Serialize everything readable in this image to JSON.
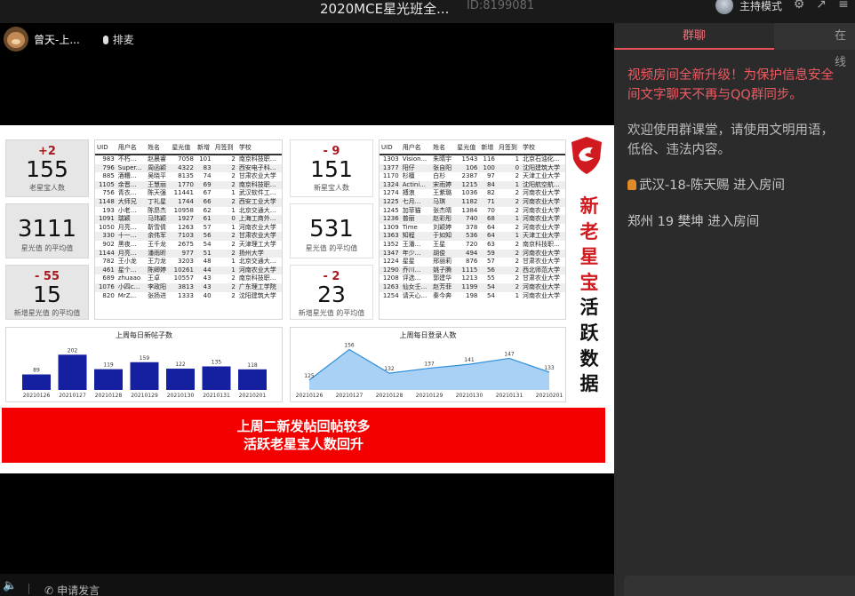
{
  "topbar": {
    "title": "2020MCE星光班全...",
    "room_id": "ID:8199081",
    "mode": "主持模式",
    "icons": [
      "settings-icon",
      "share-icon",
      "menu-icon"
    ]
  },
  "presenter": {
    "name": "曾天-上...",
    "mic_label": "排麦"
  },
  "slide": {
    "kpis": {
      "old_active": {
        "delta": "+2",
        "value": "155",
        "label": "老星宝人数"
      },
      "old_avg": {
        "value": "3111",
        "label": "星光值 的平均值"
      },
      "old_new_avg": {
        "delta": "- 55",
        "value": "15",
        "label": "新增星光值 的平均值"
      },
      "new_count": {
        "delta": "- 9",
        "value": "151",
        "label": "新星宝人数"
      },
      "new_avg": {
        "value": "531",
        "label": "星光值 的平均值"
      },
      "new_new_avg": {
        "delta": "- 2",
        "value": "23",
        "label": "新增星光值 的平均值"
      }
    },
    "table_headers": [
      "UID",
      "用户名",
      "姓名",
      "星光值",
      "新增",
      "月签到",
      "学校"
    ],
    "table_left": [
      [
        "983",
        "不朽...",
        "赵晨睿",
        "7058",
        "101",
        "2",
        "南京科技职..."
      ],
      [
        "796",
        "Super...",
        "周函颖",
        "4322",
        "83",
        "2",
        "西安电子科..."
      ],
      [
        "885",
        "酒糟...",
        "吴晓平",
        "8135",
        "74",
        "2",
        "甘肃农业大学"
      ],
      [
        "1105",
        "余晋...",
        "王慧丽",
        "1770",
        "69",
        "2",
        "南京科技职..."
      ],
      [
        "756",
        "青衣...",
        "陈天强",
        "11441",
        "67",
        "1",
        "武汉软件工..."
      ],
      [
        "1148",
        "大师兄",
        "丁礼星",
        "1744",
        "66",
        "2",
        "西安工业大学"
      ],
      [
        "193",
        "小老...",
        "陈昂杰",
        "10958",
        "62",
        "1",
        "北京交通大..."
      ],
      [
        "1091",
        "瑞颖",
        "马玮颖",
        "1927",
        "61",
        "0",
        "上海工商外..."
      ],
      [
        "1050",
        "月亮...",
        "靳雪倩",
        "1263",
        "57",
        "1",
        "河南农业大学"
      ],
      [
        "330",
        "十一...",
        "余伟军",
        "7103",
        "56",
        "2",
        "甘肃农业大学"
      ],
      [
        "902",
        "黑夜...",
        "王千龙",
        "2675",
        "54",
        "2",
        "天津理工大学"
      ],
      [
        "1144",
        "月亮...",
        "潘雨昕",
        "977",
        "51",
        "2",
        "扬州大学"
      ],
      [
        "782",
        "王小龙",
        "王力龙",
        "3203",
        "48",
        "1",
        "北京交通大..."
      ],
      [
        "461",
        "星个...",
        "陈卿婷",
        "10261",
        "44",
        "1",
        "河南农业大学"
      ],
      [
        "689",
        "zhuaao",
        "王卓",
        "10557",
        "43",
        "2",
        "南京科技职..."
      ],
      [
        "1076",
        "小四c...",
        "李政阳",
        "3813",
        "43",
        "2",
        "广东理工学院"
      ],
      [
        "820",
        "MrZ...",
        "张扬进",
        "1333",
        "40",
        "2",
        "沈阳建筑大学"
      ]
    ],
    "table_right": [
      [
        "1303",
        "Vision...",
        "朱晴宇",
        "1543",
        "116",
        "1",
        "北京石油化..."
      ],
      [
        "1377",
        "阳仔",
        "张自阳",
        "106",
        "100",
        "0",
        "沈阳建筑大学"
      ],
      [
        "1170",
        "杉檀",
        "白杉",
        "2387",
        "97",
        "2",
        "天津工业大学"
      ],
      [
        "1324",
        "Actini...",
        "宋雨婷",
        "1215",
        "84",
        "1",
        "沈阳航空航..."
      ],
      [
        "1274",
        "搏浪",
        "王紫璐",
        "1036",
        "82",
        "2",
        "河南农业大学"
      ],
      [
        "1225",
        "七月...",
        "马琪",
        "1182",
        "71",
        "2",
        "河南农业大学"
      ],
      [
        "1245",
        "加菲猫",
        "张杰晴",
        "1384",
        "70",
        "2",
        "河南农业大学"
      ],
      [
        "1236",
        "普丽",
        "赵彩彤",
        "740",
        "68",
        "1",
        "河南农业大学"
      ],
      [
        "1309",
        "Time",
        "刘颖婷",
        "378",
        "64",
        "2",
        "河南农业大学"
      ],
      [
        "1363",
        "知程",
        "于如知",
        "536",
        "64",
        "1",
        "天津工业大学"
      ],
      [
        "1352",
        "王潘...",
        "王星",
        "720",
        "63",
        "2",
        "南京科技职..."
      ],
      [
        "1347",
        "年少...",
        "胡俊",
        "494",
        "59",
        "2",
        "河南农业大学"
      ],
      [
        "1224",
        "星星",
        "邢丽莉",
        "876",
        "57",
        "2",
        "甘肃农业大学"
      ],
      [
        "1290",
        "乔川...",
        "姚子腾",
        "1115",
        "56",
        "2",
        "西北师范大学"
      ],
      [
        "1208",
        "评选...",
        "郭建华",
        "1213",
        "55",
        "2",
        "甘肃农业大学"
      ],
      [
        "1263",
        "仙女壬...",
        "赵芳菲",
        "1199",
        "54",
        "2",
        "河南农业大学"
      ],
      [
        "1254",
        "请天心...",
        "秦今奔",
        "198",
        "54",
        "1",
        "河南农业大学"
      ]
    ],
    "chart_posts_title": "上周每日新帖子数",
    "chart_logins_title": "上周每日登录人数",
    "title_red": [
      "新",
      "老",
      "星",
      "宝"
    ],
    "title_black": [
      "活",
      "跃",
      "数",
      "据"
    ],
    "banner_line1": "上周二新发帖回帖较多",
    "banner_line2": "活跃老星宝人数回升"
  },
  "chart_data": [
    {
      "type": "bar",
      "title": "上周每日新帖子数",
      "categories": [
        "20210126",
        "20210127",
        "20210128",
        "20210129",
        "20210130",
        "20210131",
        "20210201"
      ],
      "values": [
        89,
        202,
        119,
        159,
        122,
        135,
        118
      ],
      "color": "#1520a0"
    },
    {
      "type": "area",
      "title": "上周每日登录人数",
      "categories": [
        "20210126",
        "20210127",
        "20210128",
        "20210129",
        "20210130",
        "20210131",
        "20210201"
      ],
      "values": [
        125,
        156,
        132,
        137,
        141,
        147,
        133
      ],
      "color": "#2f8fd8"
    }
  ],
  "bottombar": {
    "apply_label": "申请发言"
  },
  "chat": {
    "tab_group": "群聊",
    "tab_online": "在线",
    "msg1_line1": "视频房间全新升级！为保护信息安全",
    "msg1_line2": "间文字聊天不再与QQ群同步。",
    "msg2_line1": "欢迎使用群课堂，请使用文明用语，",
    "msg2_line2": "低俗、违法内容。",
    "msg3": "武汉-18-陈天赐 进入房间",
    "msg4": "郑州 19 樊坤 进入房间"
  }
}
